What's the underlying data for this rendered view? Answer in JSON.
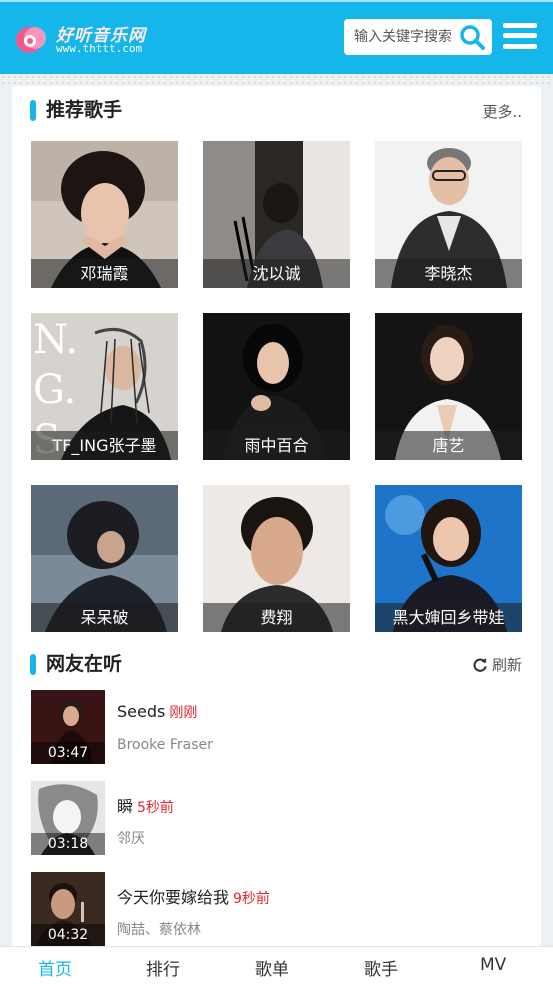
{
  "header": {
    "logo_name": "好听音乐网",
    "logo_url": "www.thttt.com",
    "search_placeholder": "输入关键字搜索",
    "search_icon": "search-icon",
    "menu_icon": "hamburger-menu-icon"
  },
  "recommend": {
    "title": "推荐歌手",
    "more": "更多..",
    "artists": [
      {
        "name": "邓瑞霞"
      },
      {
        "name": "沈以诚"
      },
      {
        "name": "李晓杰"
      },
      {
        "name": "TF_ING张子墨"
      },
      {
        "name": "雨中百合"
      },
      {
        "name": "唐艺"
      },
      {
        "name": "呆呆破"
      },
      {
        "name": "费翔"
      },
      {
        "name": "黑大婶回乡带娃"
      }
    ]
  },
  "listening": {
    "title": "网友在听",
    "refresh": "刷新",
    "refresh_icon": "refresh-icon",
    "songs": [
      {
        "title": "Seeds",
        "time": "刚刚",
        "artist": "Brooke Fraser",
        "duration": "03:47"
      },
      {
        "title": "瞬",
        "time": "5秒前",
        "artist": "邻厌",
        "duration": "03:18"
      },
      {
        "title": "今天你要嫁给我",
        "time": "9秒前",
        "artist": "陶喆、蔡依林",
        "duration": "04:32"
      }
    ]
  },
  "nav": {
    "items": [
      "首页",
      "排行",
      "歌单",
      "歌手",
      "MV"
    ],
    "active": "首页"
  },
  "colors": {
    "accent": "#15b7ea",
    "time_red": "#e0262f"
  }
}
